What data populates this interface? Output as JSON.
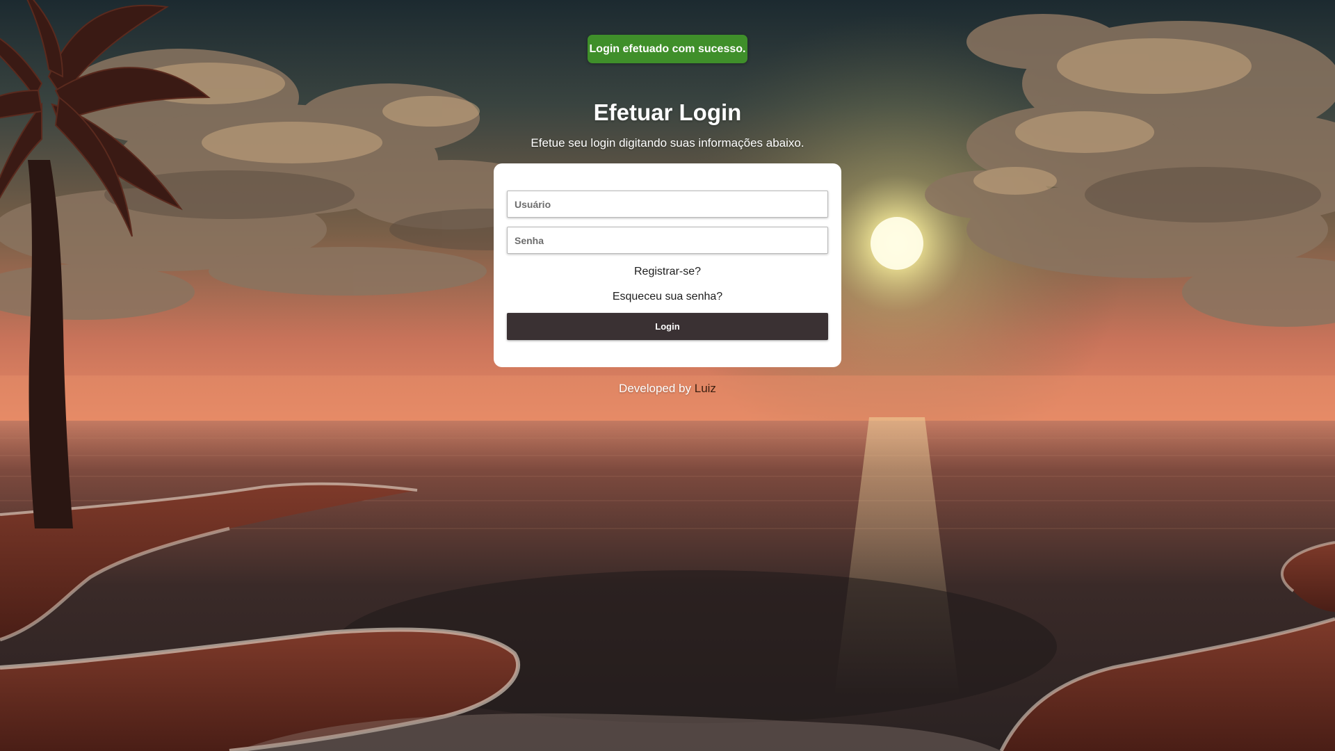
{
  "toast": {
    "message": "Login efetuado com sucesso.",
    "color": "#3f8f2a"
  },
  "header": {
    "title": "Efetuar Login",
    "subtitle": "Efetue seu login digitando suas informações abaixo."
  },
  "form": {
    "username_placeholder": "Usuário",
    "password_placeholder": "Senha",
    "register_link": "Registrar-se?",
    "forgot_link": "Esqueceu sua senha?",
    "login_button": "Login",
    "button_color": "#3a3133"
  },
  "footer": {
    "prefix": "Developed by",
    "author": "Luiz"
  },
  "background": {
    "subject": "sunset-beach-with-palm-tree"
  }
}
